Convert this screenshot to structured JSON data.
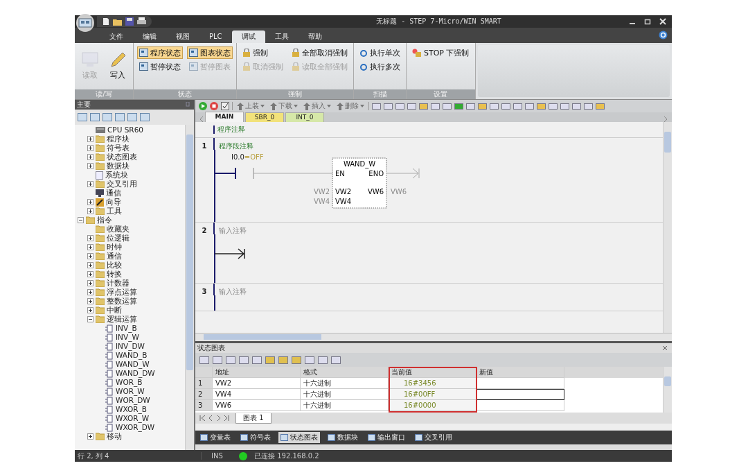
{
  "window": {
    "title": "无标题 - STEP 7-Micro/WIN SMART"
  },
  "menu_tabs": [
    {
      "label": "文件",
      "selected": false
    },
    {
      "label": "编辑",
      "selected": false
    },
    {
      "label": "视图",
      "selected": false
    },
    {
      "label": "PLC",
      "selected": false
    },
    {
      "label": "调试",
      "selected": true
    },
    {
      "label": "工具",
      "selected": false
    },
    {
      "label": "帮助",
      "selected": false
    }
  ],
  "ribbon": {
    "groups": [
      {
        "label": "读/写",
        "kind": "readwrite",
        "buttons": [
          {
            "label": "读取",
            "kind": "large",
            "disabled": true,
            "on": false
          },
          {
            "label": "写入",
            "kind": "large",
            "disabled": false,
            "on": false
          }
        ]
      },
      {
        "label": "状态",
        "kind": "status",
        "buttons": [
          {
            "label": "程序状态",
            "kind": "small",
            "disabled": false,
            "on": true
          },
          {
            "label": "暂停状态",
            "kind": "small",
            "disabled": false,
            "on": false
          },
          {
            "label": "图表状态",
            "kind": "small",
            "disabled": false,
            "on": true
          },
          {
            "label": "暂停图表",
            "kind": "small",
            "disabled": true,
            "on": false
          }
        ]
      },
      {
        "label": "强制",
        "kind": "force",
        "buttons": [
          {
            "label": "强制",
            "kind": "small",
            "disabled": false,
            "on": false
          },
          {
            "label": "取消强制",
            "kind": "small",
            "disabled": true,
            "on": false
          },
          {
            "label": "全部取消强制",
            "kind": "small",
            "disabled": false,
            "on": false
          },
          {
            "label": "读取全部强制",
            "kind": "small",
            "disabled": true,
            "on": false
          }
        ]
      },
      {
        "label": "扫描",
        "kind": "scan",
        "buttons": [
          {
            "label": "执行单次",
            "kind": "small",
            "disabled": false,
            "on": false
          },
          {
            "label": "执行多次",
            "kind": "small",
            "disabled": false,
            "on": false
          }
        ]
      },
      {
        "label": "设置",
        "kind": "setting",
        "buttons": [
          {
            "label": "STOP 下强制",
            "kind": "small",
            "disabled": false,
            "on": false
          }
        ]
      }
    ]
  },
  "left_panel": {
    "title": "主要",
    "project_items": [
      {
        "label": "CPU SR60",
        "kind": "device"
      },
      {
        "label": "程序块",
        "kind": "folder",
        "expanded": false
      },
      {
        "label": "符号表",
        "kind": "folder",
        "expanded": false
      },
      {
        "label": "状态图表",
        "kind": "folder",
        "expanded": false
      },
      {
        "label": "数据块",
        "kind": "folder",
        "expanded": false
      },
      {
        "label": "系统块",
        "kind": "page"
      },
      {
        "label": "交叉引用",
        "kind": "folder",
        "expanded": false
      },
      {
        "label": "通信",
        "kind": "screen"
      },
      {
        "label": "向导",
        "kind": "wand",
        "expanded": false
      },
      {
        "label": "工具",
        "kind": "folder",
        "expanded": false
      }
    ],
    "instructions": [
      {
        "label": "指令",
        "kind": "folder",
        "expanded": true,
        "children": [
          {
            "label": "收藏夹",
            "kind": "folder"
          },
          {
            "label": "位逻辑",
            "kind": "folder",
            "expanded": false
          },
          {
            "label": "时钟",
            "kind": "folder",
            "expanded": false
          },
          {
            "label": "通信",
            "kind": "folder",
            "expanded": false
          },
          {
            "label": "比较",
            "kind": "folder",
            "expanded": false
          },
          {
            "label": "转换",
            "kind": "folder",
            "expanded": false
          },
          {
            "label": "计数器",
            "kind": "folder",
            "expanded": false
          },
          {
            "label": "浮点运算",
            "kind": "folder",
            "expanded": false
          },
          {
            "label": "整数运算",
            "kind": "folder",
            "expanded": false
          },
          {
            "label": "中断",
            "kind": "folder",
            "expanded": false
          },
          {
            "label": "逻辑运算",
            "kind": "folder",
            "expanded": true,
            "children": [
              {
                "label": "INV_B",
                "kind": "block"
              },
              {
                "label": "INV_W",
                "kind": "block"
              },
              {
                "label": "INV_DW",
                "kind": "block"
              },
              {
                "label": "WAND_B",
                "kind": "block"
              },
              {
                "label": "WAND_W",
                "kind": "block"
              },
              {
                "label": "WAND_DW",
                "kind": "block"
              },
              {
                "label": "WOR_B",
                "kind": "block"
              },
              {
                "label": "WOR_W",
                "kind": "block"
              },
              {
                "label": "WOR_DW",
                "kind": "block"
              },
              {
                "label": "WXOR_B",
                "kind": "block"
              },
              {
                "label": "WXOR_W",
                "kind": "block"
              },
              {
                "label": "WXOR_DW",
                "kind": "block"
              }
            ]
          },
          {
            "label": "移动",
            "kind": "folder",
            "expanded": false
          }
        ]
      }
    ]
  },
  "editor_toolbar": [
    {
      "label": "上装",
      "disabled": true
    },
    {
      "label": "下载",
      "disabled": true
    },
    {
      "label": "插入",
      "disabled": true
    },
    {
      "label": "删除",
      "disabled": true
    }
  ],
  "program_tabs": [
    {
      "label": "MAIN",
      "selected": true,
      "color": "#f4f4f4"
    },
    {
      "label": "SBR_0",
      "selected": false,
      "color": "#f2e27a"
    },
    {
      "label": "INT_0",
      "selected": false,
      "color": "#d6e8a8"
    }
  ],
  "editor": {
    "program_comment": "程序注释",
    "networks": [
      {
        "number": "1",
        "comment": "程序段注释",
        "kind": "box",
        "contact": {
          "address": "I0.0",
          "state": "=OFF"
        },
        "box": {
          "name": "WAND_W",
          "en": "EN",
          "eno": "ENO",
          "inputs": [
            {
              "operand": "VW2",
              "pin": "VW2"
            },
            {
              "operand": "VW4",
              "pin": "VW4"
            }
          ],
          "outputs": [
            {
              "operand": "VW6",
              "pin": "VW6"
            }
          ]
        }
      },
      {
        "number": "2",
        "comment": "输入注释",
        "kind": "empty"
      },
      {
        "number": "3",
        "comment": "输入注释",
        "kind": "empty"
      }
    ]
  },
  "status_chart": {
    "title": "状态图表",
    "columns": [
      {
        "label": "地址",
        "highlighted": false
      },
      {
        "label": "格式",
        "highlighted": false
      },
      {
        "label": "当前值",
        "highlighted": true
      },
      {
        "label": "新值",
        "highlighted": false
      }
    ],
    "rows": [
      {
        "number": "1",
        "address": "VW2",
        "format": "十六进制",
        "current": "16#3456",
        "selected": false
      },
      {
        "number": "2",
        "address": "VW4",
        "format": "十六进制",
        "current": "16#00FF",
        "selected": true
      },
      {
        "number": "3",
        "address": "VW6",
        "format": "十六进制",
        "current": "16#0000",
        "selected": false
      }
    ],
    "sheet_tabs": [
      {
        "label": "图表 1",
        "selected": true
      }
    ]
  },
  "bottom_tabs": [
    {
      "label": "变量表",
      "selected": false
    },
    {
      "label": "符号表",
      "selected": false
    },
    {
      "label": "状态图表",
      "selected": true
    },
    {
      "label": "数据块",
      "selected": false
    },
    {
      "label": "输出窗口",
      "selected": false
    },
    {
      "label": "交叉引用",
      "selected": false
    }
  ],
  "status_bar": {
    "position": "行 2, 列 4",
    "mode": "INS",
    "connected": true,
    "connection": "已连接 192.168.0.2"
  }
}
